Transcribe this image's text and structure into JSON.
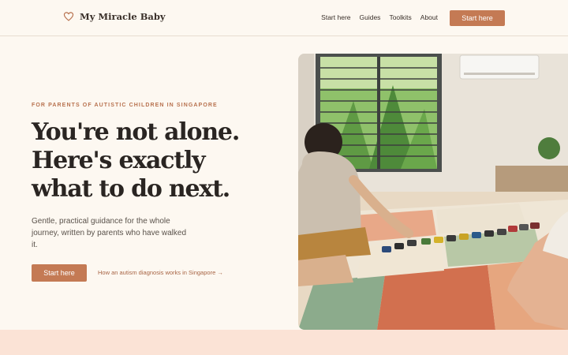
{
  "brand": {
    "name": "My Miracle Baby",
    "icon": "heart-outline-icon"
  },
  "nav": {
    "links": [
      "Start here",
      "Guides",
      "Toolkits",
      "About"
    ],
    "cta": "Start here"
  },
  "hero": {
    "eyebrow": "FOR PARENTS OF AUTISTIC CHILDREN IN SINGAPORE",
    "headline_lines": [
      "You're not alone.",
      "Here's exactly",
      "what to do next."
    ],
    "subtitle": "Gentle, practical guidance for the whole journey, written by parents who have walked it.",
    "primary_button": "Start here",
    "secondary_link": "How an autism diagnosis works in Singapore →"
  },
  "colors": {
    "accent": "#c47a54",
    "background": "#fdf8f1",
    "band": "#fbe3d6"
  }
}
